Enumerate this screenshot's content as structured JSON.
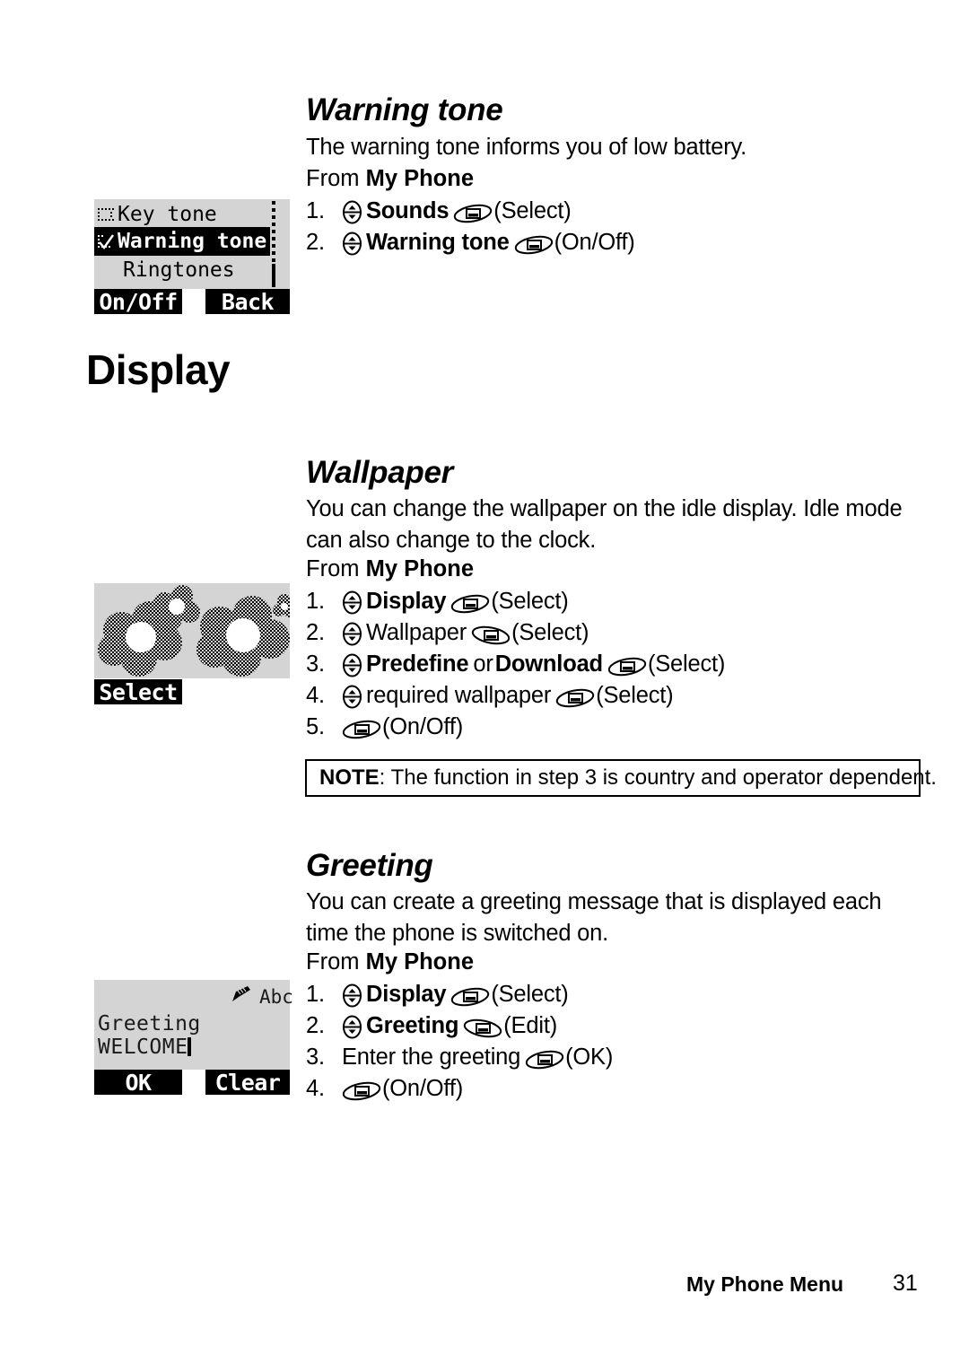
{
  "sections": {
    "warning_tone": {
      "heading": "Warning tone",
      "body": "The warning tone informs you of low battery.",
      "from_prefix": "From ",
      "from_menu": "My Phone",
      "steps": [
        {
          "num": "1.",
          "nav": true,
          "label": "Sounds",
          "bold": true,
          "soft": "left",
          "action": "(Select)"
        },
        {
          "num": "2.",
          "nav": true,
          "label": "Warning tone",
          "bold": true,
          "soft": "left",
          "action": "(On/Off)"
        }
      ],
      "screen": {
        "items": [
          {
            "label": "Key tone",
            "checked": false,
            "selected": false
          },
          {
            "label": "Warning tone",
            "checked": true,
            "selected": true
          },
          {
            "label": "Ringtones",
            "checked": false,
            "selected": false
          }
        ],
        "softkey_left": "On/Off",
        "softkey_right": "Back"
      }
    },
    "display": {
      "heading": "Display"
    },
    "wallpaper": {
      "heading": "Wallpaper",
      "body_line1": "You can change the wallpaper on the idle display. Idle mode",
      "body_line2": "can also change to the clock.",
      "from_prefix": "From ",
      "from_menu": "My Phone",
      "steps": [
        {
          "num": "1.",
          "nav": true,
          "label": "Display",
          "bold": true,
          "soft": "left",
          "action": "(Select)"
        },
        {
          "num": "2.",
          "nav": true,
          "label": "Wallpaper",
          "bold": false,
          "soft": "right",
          "action": "(Select)"
        },
        {
          "num": "3.",
          "nav": true,
          "label": "Predefine",
          "label2": " or ",
          "label3": "Download",
          "bold": true,
          "soft": "left",
          "action": "(Select)"
        },
        {
          "num": "4.",
          "nav": true,
          "label": "required wallpaper",
          "bold": false,
          "soft": "left",
          "action": "(Select)"
        },
        {
          "num": "5.",
          "nav": false,
          "label": "",
          "bold": false,
          "soft": "left",
          "action": "(On/Off)"
        }
      ],
      "note_prefix": "NOTE",
      "note_text": ": The function in step 3 is country and operator dependent.",
      "screen": {
        "softkey_left": "Select"
      }
    },
    "greeting": {
      "heading": "Greeting",
      "body_line1": "You can create a greeting message that is displayed each",
      "body_line2": "time the phone is switched on.",
      "from_prefix": "From ",
      "from_menu": "My Phone",
      "steps": [
        {
          "num": "1.",
          "nav": true,
          "label": "Display",
          "bold": true,
          "soft": "left",
          "action": "(Select)"
        },
        {
          "num": "2.",
          "nav": true,
          "label": "Greeting",
          "bold": true,
          "soft": "right",
          "action": "(Edit)"
        },
        {
          "num": "3.",
          "nav": false,
          "label": "Enter the greeting",
          "bold": false,
          "soft": "left",
          "action": "(OK)"
        },
        {
          "num": "4.",
          "nav": false,
          "label": "",
          "bold": false,
          "soft": "left",
          "action": "(On/Off)"
        }
      ],
      "screen": {
        "mode_label": "Abc",
        "mode_icon": "pencil-icon",
        "field_label": "Greeting",
        "field_value": "WELCOME",
        "softkey_left": "OK",
        "softkey_right": "Clear"
      }
    }
  },
  "footer": {
    "title": "My Phone Menu",
    "page": "31"
  },
  "colors": {
    "lcd_background": "#d4d4d4",
    "ink": "#000000",
    "page_background": "#ffffff"
  },
  "icons": {
    "nav_key": "nav-key-icon",
    "soft_key_left": "left-soft-key-icon",
    "soft_key_right": "right-soft-key-icon",
    "checkbox_empty": "checkbox-empty-icon",
    "checkbox_checked": "checkbox-checked-icon"
  }
}
